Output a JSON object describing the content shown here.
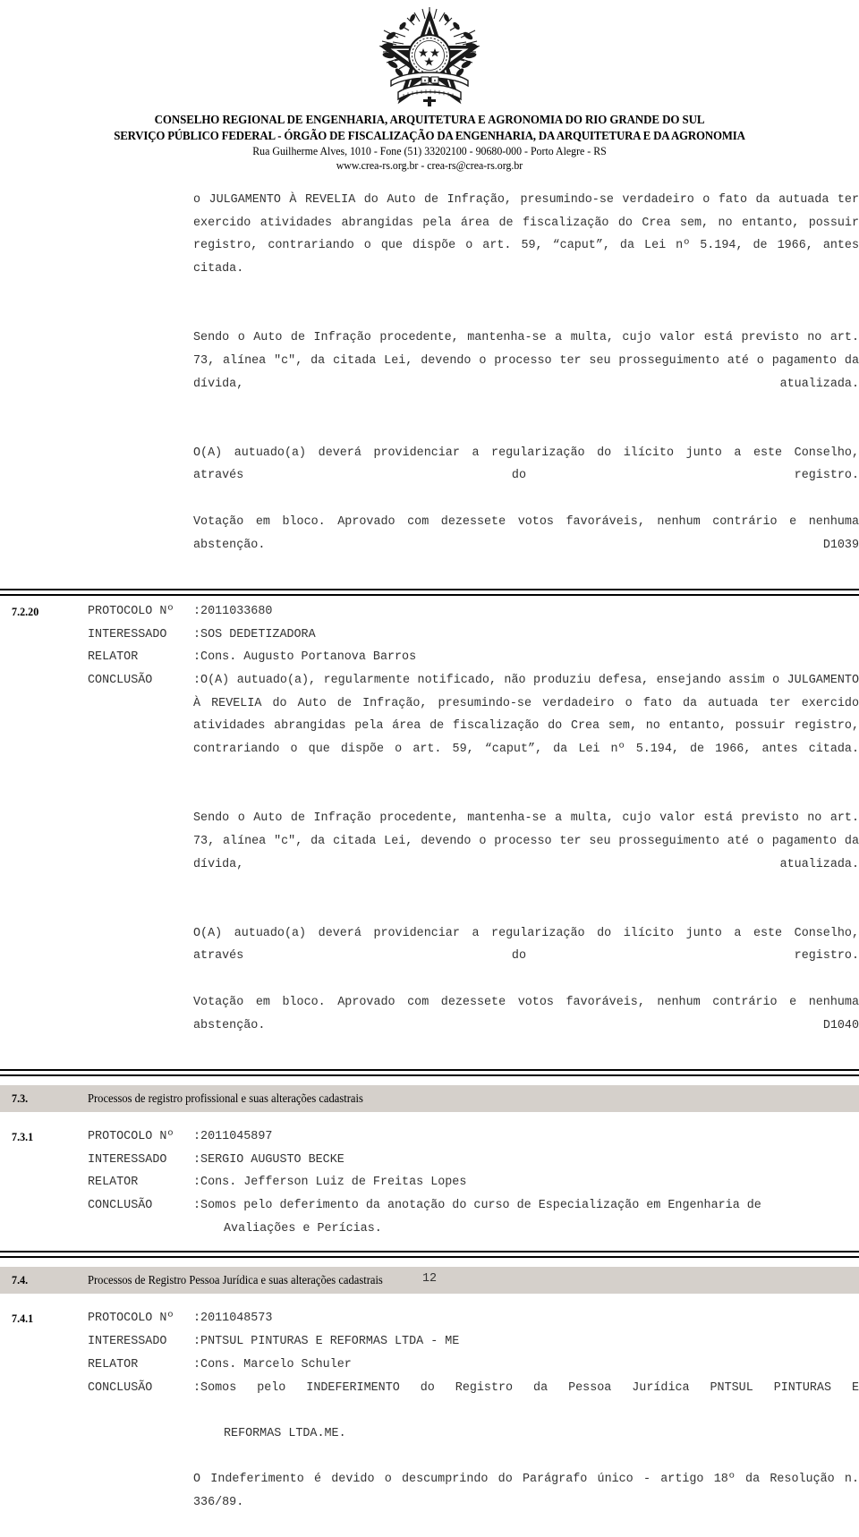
{
  "header": {
    "emblem_name": "brazil-coat-of-arms",
    "org_line_1": "CONSELHO REGIONAL DE ENGENHARIA, ARQUITETURA E AGRONOMIA DO RIO GRANDE DO SUL",
    "org_line_2": "SERVIÇO PÚBLICO FEDERAL - ÓRGÃO DE FISCALIZAÇÃO DA ENGENHARIA, DA ARQUITETURA E DA AGRONOMIA",
    "address": "Rua Guilherme Alves, 1010 - Fone (51) 33202100 - 90680-000 - Porto Alegre - RS",
    "web": "www.crea-rs.org.br - crea-rs@crea-rs.org.br"
  },
  "top_block": {
    "para1": "o JULGAMENTO À REVELIA do Auto de Infração, presumindo-se verdadeiro o fato da autuada ter exercido atividades abrangidas pela área de fiscalização do Crea sem, no entanto, possuir registro, contrariando o que dispõe o art. 59, “caput”, da Lei nº 5.194, de 1966, antes citada.",
    "para2": "Sendo o Auto de Infração procedente, mantenha-se a multa, cujo valor está previsto no art. 73, alínea \"c\", da citada Lei, devendo o processo ter seu prosseguimento até o pagamento da dívida, atualizada.",
    "para3": "O(A) autuado(a) deverá providenciar a regularização do ilícito junto a este Conselho, através do registro.",
    "para4": "Votação em bloco. Aprovado com dezessete votos favoráveis, nenhum contrário e nenhuma abstenção. D1039"
  },
  "labels": {
    "protocolo": "PROTOCOLO Nº",
    "interessado": "INTERESSADO",
    "relator": "RELATOR",
    "conclusao": "CONCLUSÃO",
    "colon": ":"
  },
  "items": [
    {
      "number": "7.2.20",
      "protocolo": "2011033680",
      "interessado": "SOS DEDETIZADORA",
      "relator": "Cons. Augusto Portanova Barros",
      "conclusao": "O(A) autuado(a), regularmente notificado, não produziu defesa, ensejando assim o JULGAMENTO À REVELIA do Auto de Infração, presumindo-se verdadeiro o fato da autuada ter exercido atividades abrangidas pela área de fiscalização do Crea sem, no entanto, possuir registro, contrariando o que dispõe o art. 59, “caput”, da Lei nº 5.194, de 1966, antes citada.",
      "paragraphs": [
        "Sendo o Auto de Infração procedente, mantenha-se a multa, cujo valor está previsto no art. 73, alínea \"c\", da citada Lei, devendo o processo ter seu prosseguimento até o pagamento da dívida, atualizada.",
        "O(A) autuado(a) deverá providenciar a regularização do ilícito junto a este Conselho, através do registro.",
        "Votação em bloco. Aprovado com dezessete votos favoráveis, nenhum contrário e nenhuma abstenção. D1040"
      ]
    }
  ],
  "section_73": {
    "number": "7.3.",
    "title": "Processos de registro profissional e suas alterações cadastrais",
    "item": {
      "number": "7.3.1",
      "protocolo": "2011045897",
      "interessado": "SERGIO AUGUSTO BECKE",
      "relator": "Cons. Jefferson Luiz de Freitas Lopes",
      "conclusao": "Somos pelo deferimento da anotação do curso de Especialização em Engenharia de",
      "conclusao_cont": "Avaliações e Perícias."
    }
  },
  "section_74": {
    "number": "7.4.",
    "title": "Processos de Registro Pessoa Jurídica e suas alterações cadastrais",
    "item": {
      "number": "7.4.1",
      "protocolo": "2011048573",
      "interessado": "PNTSUL PINTURAS E REFORMAS LTDA - ME",
      "relator": "Cons. Marcelo Schuler",
      "conclusao": "Somos pelo INDEFERIMENTO do Registro da Pessoa Jurídica PNTSUL PINTURAS E",
      "conclusao_cont": "REFORMAS LTDA.ME.",
      "paragraphs": [
        "O Indeferimento é devido o descumprindo do Parágrafo único - artigo 18º da Resolução n. 336/89."
      ]
    }
  },
  "footer": {
    "page_number": "12"
  },
  "colors": {
    "band_background": "#d5d0cb",
    "text": "#333333",
    "rule": "#000000",
    "page_background": "#ffffff"
  }
}
